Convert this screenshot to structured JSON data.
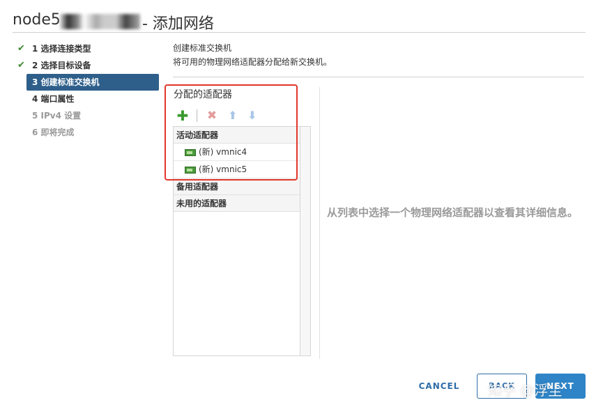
{
  "dialog": {
    "host_name": "node5",
    "title_suffix": "- 添加网络"
  },
  "steps": [
    {
      "label": "1 选择连接类型",
      "status": "completed",
      "check_icon": "check-icon"
    },
    {
      "label": "2 选择目标设备",
      "status": "completed",
      "check_icon": "check-icon"
    },
    {
      "label": "3 创建标准交换机",
      "status": "active"
    },
    {
      "label": "4 端口属性",
      "status": "pending"
    },
    {
      "label": "5 IPv4 设置",
      "status": "disabled"
    },
    {
      "label": "6 即将完成",
      "status": "disabled"
    }
  ],
  "content": {
    "title": "创建标准交换机",
    "description": "将可用的物理网络适配器分配给新交换机。"
  },
  "adapters": {
    "heading": "分配的适配器",
    "toolbar": {
      "add_icon": "plus-icon",
      "remove_icon": "x-icon",
      "move_up_icon": "arrow-up-icon",
      "move_down_icon": "arrow-down-icon"
    },
    "groups": [
      {
        "label": "活动适配器",
        "items": [
          "(新) vmnic4",
          "(新) vmnic5"
        ]
      },
      {
        "label": "备用适配器",
        "items": []
      },
      {
        "label": "未用的适配器",
        "items": []
      }
    ],
    "nic_icon": "network-card-icon"
  },
  "detail_hint": "从列表中选择一个物理网络适配器以查看其详细信息。",
  "footer": {
    "cancel_label": "CANCEL",
    "back_label": "BACK",
    "next_label": "NEXT"
  },
  "watermark": "知乎 @浮尘",
  "colors": {
    "accent": "#2e84c6",
    "active_step_bg": "#2e5f8a",
    "check_green": "#3c8a2e",
    "highlight_red": "#e2362b"
  }
}
